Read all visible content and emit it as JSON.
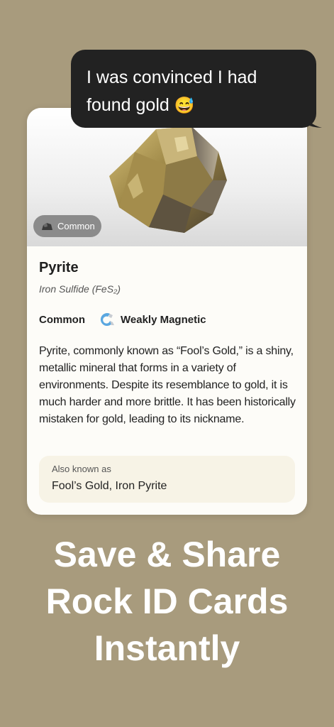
{
  "bubble": {
    "line1": "I was convinced I had",
    "line2": "found gold",
    "emoji": "😅"
  },
  "card": {
    "rarity_badge": "Common",
    "name": "Pyrite",
    "formula": "Iron Sulfide (FeS₂)",
    "rarity": "Common",
    "magnetism": "Weakly Magnetic",
    "description": "Pyrite, commonly known as “Fool’s Gold,” is a shiny, metallic mineral that forms in a variety of environments. Despite its resemblance to gold, it is much harder and more brittle. It has been historically mistaken for gold, leading to its nickname.",
    "aka_label": "Also known as",
    "aka_value": "Fool’s Gold, Iron Pyrite"
  },
  "headline": {
    "line1": "Save & Share",
    "line2": "Rock ID Cards",
    "line3": "Instantly"
  },
  "colors": {
    "background": "#a89b7d",
    "bubble": "#222222",
    "card": "#fdfcf8",
    "aka_box": "#f7f3e6",
    "badge": "#8b8b8b"
  },
  "icons": {
    "rock": "pyrite-rock-image",
    "badge": "rock-icon",
    "magnet": "magnet-icon"
  }
}
